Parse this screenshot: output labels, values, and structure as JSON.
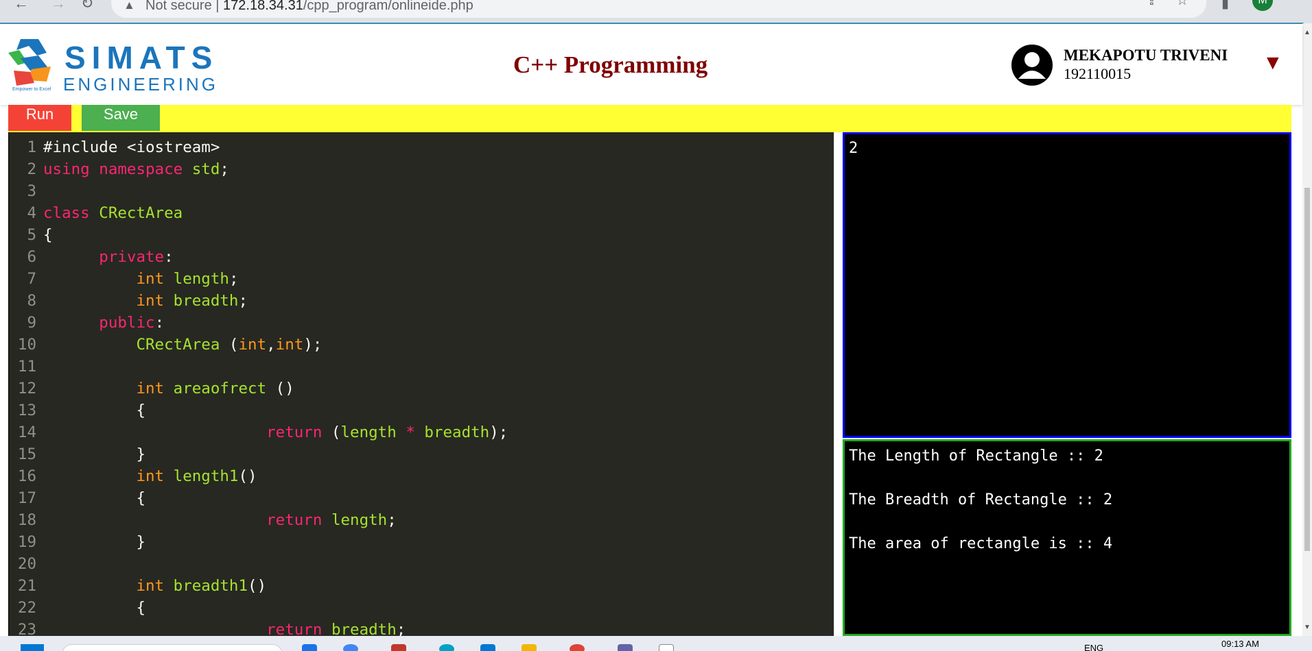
{
  "browser": {
    "security_label": "Not secure",
    "separator": "|",
    "url_host": "172.18.34.31",
    "url_path": "/cpp_program/onlineide.php",
    "profile_initial": "M"
  },
  "header": {
    "brand_top": "SIMATS",
    "brand_bottom": "ENGINEERING",
    "tagline": "Empower to Excel",
    "title": "C++ Programming",
    "user_name": "MEKAPOTU TRIVENI",
    "user_id": "192110015",
    "dropdown_glyph": "▼"
  },
  "toolbar": {
    "run_label": "Run",
    "save_label": "Save"
  },
  "editor": {
    "lines": [
      {
        "n": "1",
        "tokens": [
          [
            "pl",
            "#include <iostream>"
          ]
        ]
      },
      {
        "n": "2",
        "tokens": [
          [
            "kw",
            "using"
          ],
          [
            "pl",
            " "
          ],
          [
            "kw",
            "namespace"
          ],
          [
            "pl",
            " "
          ],
          [
            "fn",
            "std"
          ],
          [
            "pl",
            ";"
          ]
        ]
      },
      {
        "n": "3",
        "tokens": []
      },
      {
        "n": "4",
        "tokens": [
          [
            "kw",
            "class"
          ],
          [
            "pl",
            " "
          ],
          [
            "fn",
            "CRectArea"
          ]
        ]
      },
      {
        "n": "5",
        "tokens": [
          [
            "pl",
            "{"
          ]
        ]
      },
      {
        "n": "6",
        "tokens": [
          [
            "pl",
            "      "
          ],
          [
            "kw",
            "private"
          ],
          [
            "pl",
            ":"
          ]
        ]
      },
      {
        "n": "7",
        "tokens": [
          [
            "pl",
            "          "
          ],
          [
            "ty",
            "int"
          ],
          [
            "pl",
            " "
          ],
          [
            "fn",
            "length"
          ],
          [
            "pl",
            ";"
          ]
        ]
      },
      {
        "n": "8",
        "tokens": [
          [
            "pl",
            "          "
          ],
          [
            "ty",
            "int"
          ],
          [
            "pl",
            " "
          ],
          [
            "fn",
            "breadth"
          ],
          [
            "pl",
            ";"
          ]
        ]
      },
      {
        "n": "9",
        "tokens": [
          [
            "pl",
            "      "
          ],
          [
            "kw",
            "public"
          ],
          [
            "pl",
            ":"
          ]
        ]
      },
      {
        "n": "10",
        "tokens": [
          [
            "pl",
            "          "
          ],
          [
            "fn",
            "CRectArea"
          ],
          [
            "pl",
            " ("
          ],
          [
            "ty",
            "int"
          ],
          [
            "pl",
            ","
          ],
          [
            "ty",
            "int"
          ],
          [
            "pl",
            ");"
          ]
        ]
      },
      {
        "n": "11",
        "tokens": []
      },
      {
        "n": "12",
        "tokens": [
          [
            "pl",
            "          "
          ],
          [
            "ty",
            "int"
          ],
          [
            "pl",
            " "
          ],
          [
            "fn",
            "areaofrect"
          ],
          [
            "pl",
            " ()"
          ]
        ]
      },
      {
        "n": "13",
        "tokens": [
          [
            "pl",
            "          {"
          ]
        ]
      },
      {
        "n": "14",
        "tokens": [
          [
            "pl",
            "                        "
          ],
          [
            "kw",
            "return"
          ],
          [
            "pl",
            " ("
          ],
          [
            "fn",
            "length"
          ],
          [
            "pl",
            " "
          ],
          [
            "kw",
            "*"
          ],
          [
            "pl",
            " "
          ],
          [
            "fn",
            "breadth"
          ],
          [
            "pl",
            ");"
          ]
        ]
      },
      {
        "n": "15",
        "tokens": [
          [
            "pl",
            "          }"
          ]
        ]
      },
      {
        "n": "16",
        "tokens": [
          [
            "pl",
            "          "
          ],
          [
            "ty",
            "int"
          ],
          [
            "pl",
            " "
          ],
          [
            "fn",
            "length1"
          ],
          [
            "pl",
            "()"
          ]
        ]
      },
      {
        "n": "17",
        "tokens": [
          [
            "pl",
            "          {"
          ]
        ]
      },
      {
        "n": "18",
        "tokens": [
          [
            "pl",
            "                        "
          ],
          [
            "kw",
            "return"
          ],
          [
            "pl",
            " "
          ],
          [
            "fn",
            "length"
          ],
          [
            "pl",
            ";"
          ]
        ]
      },
      {
        "n": "19",
        "tokens": [
          [
            "pl",
            "          }"
          ]
        ]
      },
      {
        "n": "20",
        "tokens": []
      },
      {
        "n": "21",
        "tokens": [
          [
            "pl",
            "          "
          ],
          [
            "ty",
            "int"
          ],
          [
            "pl",
            " "
          ],
          [
            "fn",
            "breadth1"
          ],
          [
            "pl",
            "()"
          ]
        ]
      },
      {
        "n": "22",
        "tokens": [
          [
            "pl",
            "          {"
          ]
        ]
      },
      {
        "n": "23",
        "tokens": [
          [
            "pl",
            "                        "
          ],
          [
            "kw",
            "return"
          ],
          [
            "pl",
            " "
          ],
          [
            "fn",
            "breadth"
          ],
          [
            "pl",
            ";"
          ]
        ]
      }
    ]
  },
  "input_panel": {
    "value": "2"
  },
  "output_panel": {
    "lines": [
      "The Length of Rectangle :: 2",
      "",
      "The Breadth of Rectangle :: 2",
      "",
      "The area of rectangle is :: 4"
    ]
  },
  "taskbar": {
    "lang": "ENG",
    "time": "09:13 AM"
  },
  "colors": {
    "title": "#800000",
    "brand": "#1b75bc",
    "run": "#f44336",
    "save": "#4caf50",
    "toolbar_bg": "#ffff33",
    "editor_bg": "#272822",
    "input_border": "#0000ff",
    "output_border": "#22aa22"
  }
}
